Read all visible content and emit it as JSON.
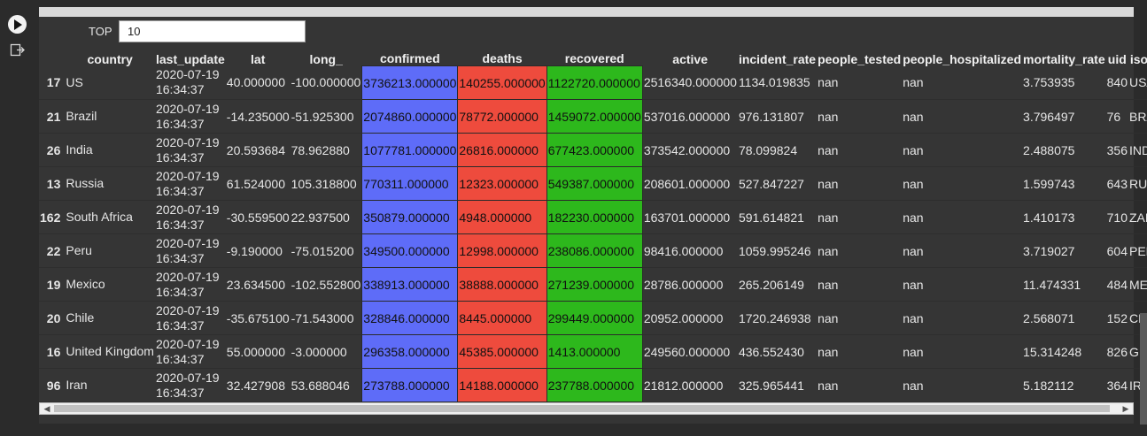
{
  "colors": {
    "confirmed": "#5e6cf8",
    "deaths": "#ee4b3d",
    "recovered": "#2db81c"
  },
  "controls": {
    "top_label": "TOP",
    "top_value": "10"
  },
  "table": {
    "columns": [
      "country",
      "last_update",
      "lat",
      "long_",
      "confirmed",
      "deaths",
      "recovered",
      "active",
      "incident_rate",
      "people_tested",
      "people_hospitalized",
      "mortality_rate",
      "uid",
      "iso"
    ],
    "rows": [
      {
        "idx": "17",
        "country": "US",
        "date": "2020-07-19",
        "time": "16:34:37",
        "lat": "40.000000",
        "long": "-100.000000",
        "confirmed": "3736213.000000",
        "deaths": "140255.000000",
        "recovered": "1122720.000000",
        "active": "2516340.000000",
        "incident_rate": "1134.019835",
        "people_tested": "nan",
        "people_hospitalized": "nan",
        "mortality_rate": "3.753935",
        "uid": "840",
        "iso": "USA"
      },
      {
        "idx": "21",
        "country": "Brazil",
        "date": "2020-07-19",
        "time": "16:34:37",
        "lat": "-14.235000",
        "long": "-51.925300",
        "confirmed": "2074860.000000",
        "deaths": "78772.000000",
        "recovered": "1459072.000000",
        "active": "537016.000000",
        "incident_rate": "976.131807",
        "people_tested": "nan",
        "people_hospitalized": "nan",
        "mortality_rate": "3.796497",
        "uid": "76",
        "iso": "BRA"
      },
      {
        "idx": "26",
        "country": "India",
        "date": "2020-07-19",
        "time": "16:34:37",
        "lat": "20.593684",
        "long": "78.962880",
        "confirmed": "1077781.000000",
        "deaths": "26816.000000",
        "recovered": "677423.000000",
        "active": "373542.000000",
        "incident_rate": "78.099824",
        "people_tested": "nan",
        "people_hospitalized": "nan",
        "mortality_rate": "2.488075",
        "uid": "356",
        "iso": "IND"
      },
      {
        "idx": "13",
        "country": "Russia",
        "date": "2020-07-19",
        "time": "16:34:37",
        "lat": "61.524000",
        "long": "105.318800",
        "confirmed": "770311.000000",
        "deaths": "12323.000000",
        "recovered": "549387.000000",
        "active": "208601.000000",
        "incident_rate": "527.847227",
        "people_tested": "nan",
        "people_hospitalized": "nan",
        "mortality_rate": "1.599743",
        "uid": "643",
        "iso": "RUS"
      },
      {
        "idx": "162",
        "country": "South Africa",
        "date": "2020-07-19",
        "time": "16:34:37",
        "lat": "-30.559500",
        "long": "22.937500",
        "confirmed": "350879.000000",
        "deaths": "4948.000000",
        "recovered": "182230.000000",
        "active": "163701.000000",
        "incident_rate": "591.614821",
        "people_tested": "nan",
        "people_hospitalized": "nan",
        "mortality_rate": "1.410173",
        "uid": "710",
        "iso": "ZAF"
      },
      {
        "idx": "22",
        "country": "Peru",
        "date": "2020-07-19",
        "time": "16:34:37",
        "lat": "-9.190000",
        "long": "-75.015200",
        "confirmed": "349500.000000",
        "deaths": "12998.000000",
        "recovered": "238086.000000",
        "active": "98416.000000",
        "incident_rate": "1059.995246",
        "people_tested": "nan",
        "people_hospitalized": "nan",
        "mortality_rate": "3.719027",
        "uid": "604",
        "iso": "PER"
      },
      {
        "idx": "19",
        "country": "Mexico",
        "date": "2020-07-19",
        "time": "16:34:37",
        "lat": "23.634500",
        "long": "-102.552800",
        "confirmed": "338913.000000",
        "deaths": "38888.000000",
        "recovered": "271239.000000",
        "active": "28786.000000",
        "incident_rate": "265.206149",
        "people_tested": "nan",
        "people_hospitalized": "nan",
        "mortality_rate": "11.474331",
        "uid": "484",
        "iso": "MEX"
      },
      {
        "idx": "20",
        "country": "Chile",
        "date": "2020-07-19",
        "time": "16:34:37",
        "lat": "-35.675100",
        "long": "-71.543000",
        "confirmed": "328846.000000",
        "deaths": "8445.000000",
        "recovered": "299449.000000",
        "active": "20952.000000",
        "incident_rate": "1720.246938",
        "people_tested": "nan",
        "people_hospitalized": "nan",
        "mortality_rate": "2.568071",
        "uid": "152",
        "iso": "CHL"
      },
      {
        "idx": "16",
        "country": "United Kingdom",
        "date": "2020-07-19",
        "time": "16:34:37",
        "lat": "55.000000",
        "long": "-3.000000",
        "confirmed": "296358.000000",
        "deaths": "45385.000000",
        "recovered": "1413.000000",
        "active": "249560.000000",
        "incident_rate": "436.552430",
        "people_tested": "nan",
        "people_hospitalized": "nan",
        "mortality_rate": "15.314248",
        "uid": "826",
        "iso": "GBR"
      },
      {
        "idx": "96",
        "country": "Iran",
        "date": "2020-07-19",
        "time": "16:34:37",
        "lat": "32.427908",
        "long": "53.688046",
        "confirmed": "273788.000000",
        "deaths": "14188.000000",
        "recovered": "237788.000000",
        "active": "21812.000000",
        "incident_rate": "325.965441",
        "people_tested": "nan",
        "people_hospitalized": "nan",
        "mortality_rate": "5.182112",
        "uid": "364",
        "iso": "IRN"
      }
    ]
  }
}
